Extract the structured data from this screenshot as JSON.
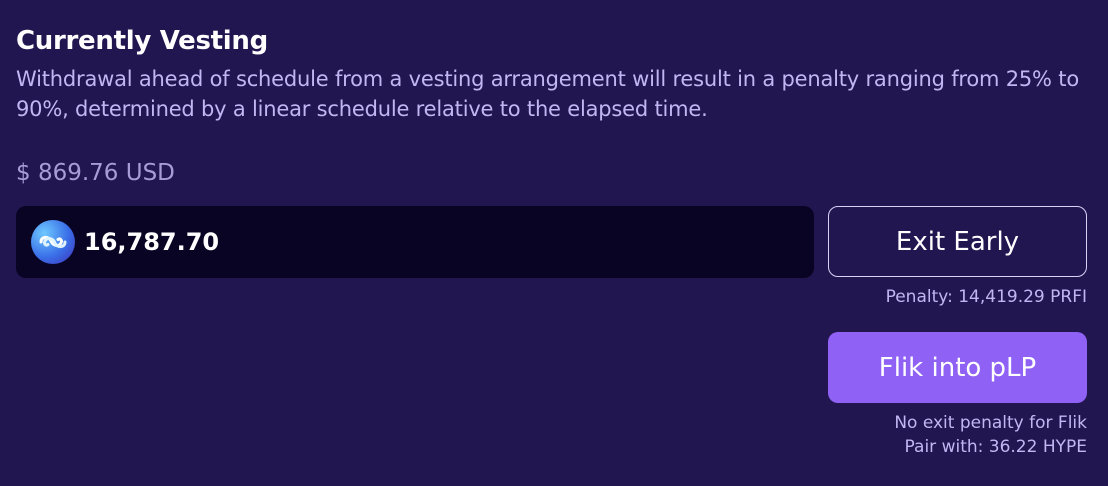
{
  "section": {
    "title": "Currently Vesting",
    "description": "Withdrawal ahead of schedule from a vesting arrangement will result in a penalty ranging from 25% to 90%, determined by a linear schedule relative to the elapsed time."
  },
  "vesting": {
    "usd_value": "$ 869.76 USD",
    "token_amount": "16,787.70",
    "token_icon": "prfi-token-icon"
  },
  "actions": {
    "exit_label": "Exit Early",
    "penalty_text": "Penalty: 14,419.29 PRFI",
    "flik_label": "Flik into pLP",
    "flik_note": "No exit penalty for Flik",
    "pair_text": "Pair with: 36.22 HYPE"
  },
  "colors": {
    "background": "#221650",
    "input_background": "#0a0424",
    "accent": "#8f62f5",
    "muted_text": "#c2b6f2"
  }
}
